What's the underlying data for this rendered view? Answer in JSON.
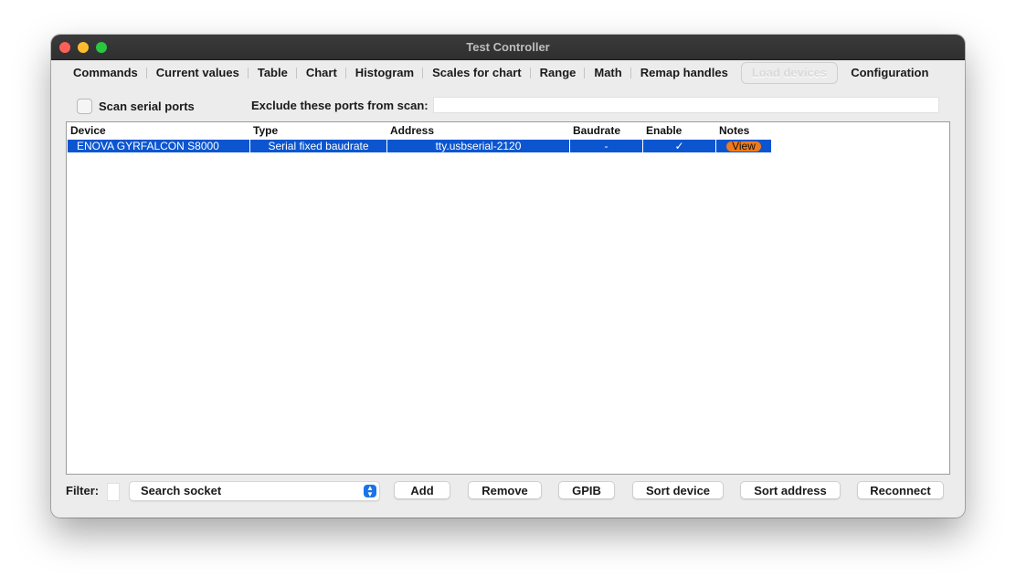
{
  "window": {
    "title": "Test Controller"
  },
  "tabs": [
    {
      "label": "Commands"
    },
    {
      "label": "Current values"
    },
    {
      "label": "Table"
    },
    {
      "label": "Chart"
    },
    {
      "label": "Histogram"
    },
    {
      "label": "Scales for chart"
    },
    {
      "label": "Range"
    },
    {
      "label": "Math"
    },
    {
      "label": "Remap handles"
    },
    {
      "label": "Load devices"
    },
    {
      "label": "Configuration"
    }
  ],
  "scan": {
    "checkbox_label": "Scan serial ports",
    "exclude_label": "Exclude these ports from scan:",
    "exclude_value": ""
  },
  "table": {
    "columns": [
      "Device",
      "Type",
      "Address",
      "Baudrate",
      "Enable",
      "Notes"
    ],
    "rows": [
      {
        "device": "ENOVA GYRFALCON S8000",
        "type": "Serial fixed baudrate",
        "address": "tty.usbserial-2120",
        "baudrate": "-",
        "enable": "✓",
        "notes": "View"
      }
    ]
  },
  "bottom": {
    "filter_label": "Filter:",
    "select_value": "Search socket",
    "buttons": {
      "add": "Add",
      "remove": "Remove",
      "gpib": "GPIB",
      "sort_device": "Sort device",
      "sort_address": "Sort address",
      "reconnect": "Reconnect"
    }
  },
  "colors": {
    "selection": "#0b56d0",
    "view_button": "#f07a1c",
    "accent": "#1a73e8"
  }
}
